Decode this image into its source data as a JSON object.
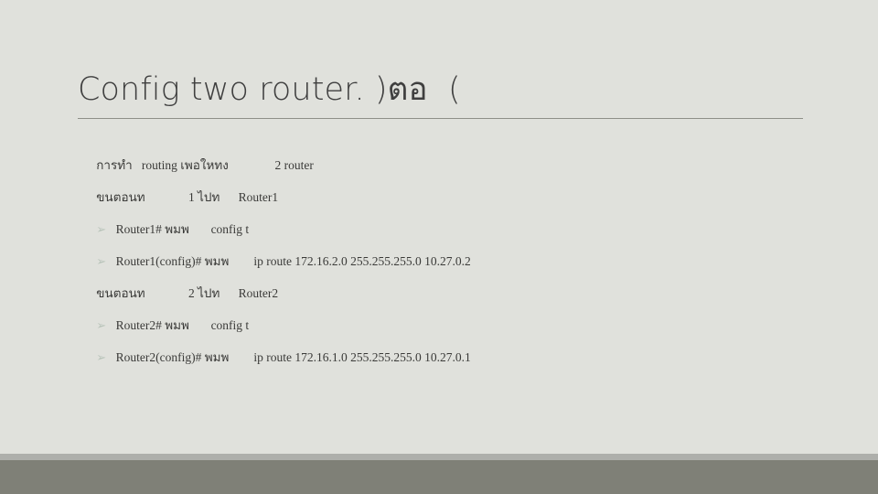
{
  "slide": {
    "title": "Config two router. )ตอ  (",
    "background_color": "#e0e1dc",
    "text_color": "#3a3a38",
    "title_color": "#3f3f3f",
    "rule_color": "#8e8f88",
    "bullet_glyph": "➢",
    "bullet_color": "#b9c4ba",
    "footer_strip_color": "#aeafab",
    "footer_bar_color": "#7f8077",
    "lines": [
      {
        "bullet": "",
        "text": "การทำ   routing เพอใหทง               2 router"
      },
      {
        "bullet": "",
        "text": "ขนตอนท              1 ไปท      Router1"
      },
      {
        "bullet": "➢",
        "text": " Router1# พมพ       config t"
      },
      {
        "bullet": "➢",
        "text": " Router1(config)# พมพ        ip route 172.16.2.0 255.255.255.0 10.27.0.2"
      },
      {
        "bullet": "",
        "text": "ขนตอนท              2 ไปท      Router2"
      },
      {
        "bullet": "➢",
        "text": " Router2# พมพ       config t"
      },
      {
        "bullet": "➢",
        "text": " Router2(config)# พมพ        ip route 172.16.1.0 255.255.255.0 10.27.0.1"
      }
    ]
  }
}
